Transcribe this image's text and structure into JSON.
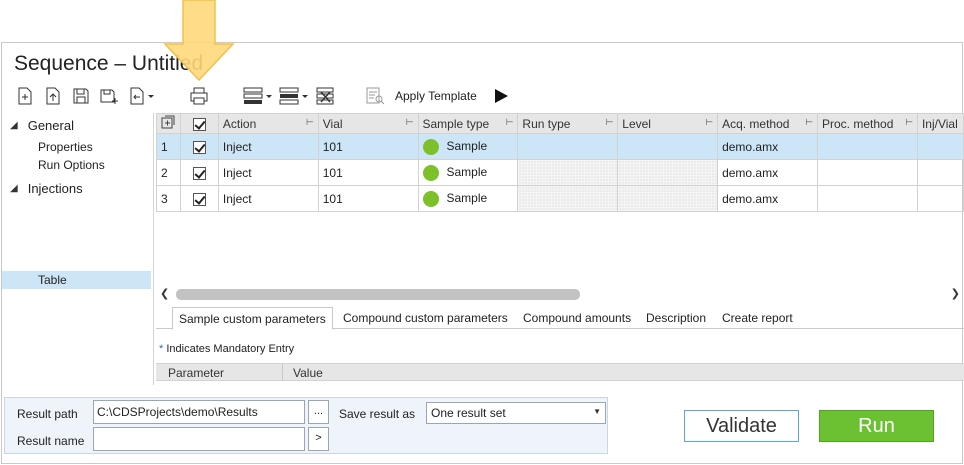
{
  "title": "Sequence – Untitled",
  "toolbar": {
    "apply_template": "Apply Template",
    "icons": [
      "new-icon",
      "upload-icon",
      "save-icon",
      "save-as-icon",
      "append-icon",
      "print-icon",
      "insert-row-icon",
      "row-options-icon",
      "delete-rows-icon",
      "template-icon",
      "play-icon"
    ]
  },
  "nav": {
    "general": "General",
    "properties": "Properties",
    "run_options": "Run Options",
    "injections": "Injections",
    "table": "Table"
  },
  "grid": {
    "columns": [
      "Action",
      "Vial",
      "Sample type",
      "Run type",
      "Level",
      "Acq. method",
      "Proc. method",
      "Inj/Vial"
    ],
    "rows": [
      {
        "num": "1",
        "action": "Inject",
        "vial": "101",
        "sample_type": "Sample",
        "acq_method": "demo.amx"
      },
      {
        "num": "2",
        "action": "Inject",
        "vial": "101",
        "sample_type": "Sample",
        "acq_method": "demo.amx"
      },
      {
        "num": "3",
        "action": "Inject",
        "vial": "101",
        "sample_type": "Sample",
        "acq_method": "demo.amx"
      }
    ]
  },
  "tabs": [
    "Sample custom parameters",
    "Compound custom parameters",
    "Compound amounts",
    "Description",
    "Create report"
  ],
  "mandatory_note": "Indicates Mandatory Entry",
  "param_table": {
    "parameter": "Parameter",
    "value": "Value"
  },
  "bottom": {
    "result_path_label": "Result path",
    "result_path_value": "C:\\CDSProjects\\demo\\Results",
    "browse_label": "...",
    "result_name_label": "Result name",
    "result_name_value": "",
    "name_btn_label": ">",
    "save_as_label": "Save result as",
    "save_as_value": "One result set"
  },
  "buttons": {
    "validate": "Validate",
    "run": "Run"
  },
  "colors": {
    "selection": "#cde6f7",
    "run": "#6cc132",
    "validate_border": "#5aa7d6",
    "sample_dot": "#7dc12a",
    "callout_arrow": "#ffd87a"
  }
}
